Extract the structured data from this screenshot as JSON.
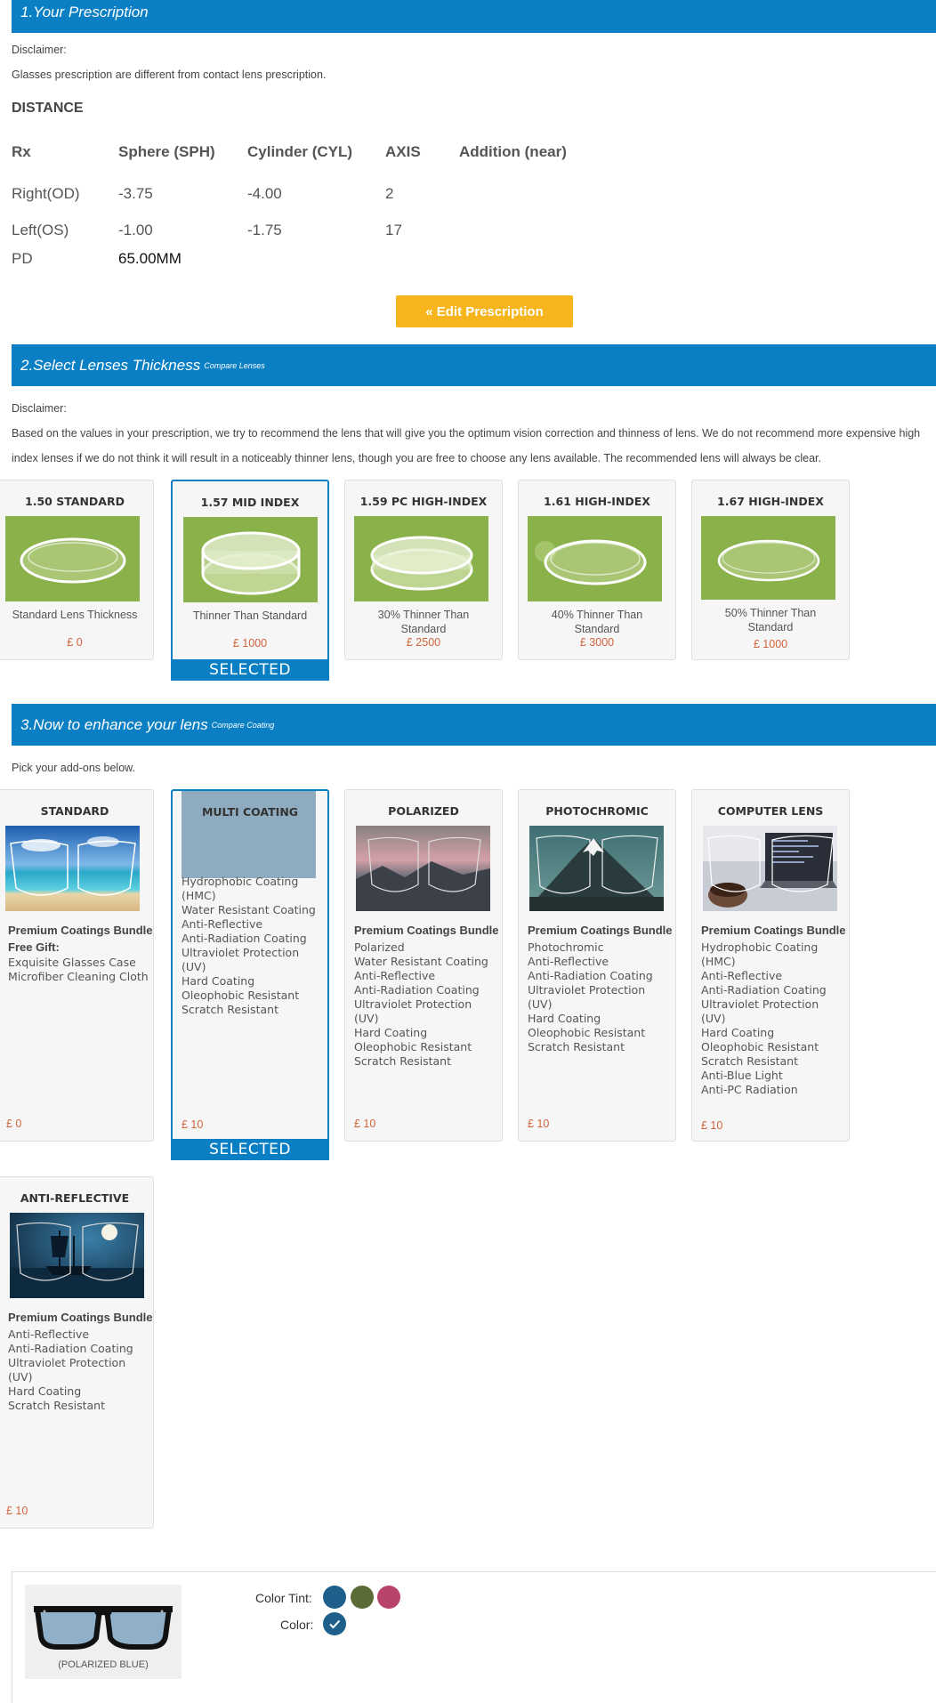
{
  "section1": {
    "title": "1.Your Prescription",
    "disclaimer_label": "Disclaimer:",
    "disclaimer_text": "Glasses prescription are different from contact lens prescription.",
    "distance_heading": "DISTANCE",
    "columns": [
      "Rx",
      "Sphere (SPH)",
      "Cylinder (CYL)",
      "AXIS",
      "Addition (near)"
    ],
    "rows": [
      {
        "label": "Right(OD)",
        "sph": "-3.75",
        "cyl": "-4.00",
        "axis": "2"
      },
      {
        "label": "Left(OS)",
        "sph": "-1.00",
        "cyl": "-1.75",
        "axis": "17"
      }
    ],
    "pd_label": "PD",
    "pd_value": "65.00MM",
    "edit_button": "« Edit Prescription"
  },
  "section2": {
    "title": "2.Select Lenses Thickness",
    "compare_link": "Compare Lenses",
    "disclaimer_label": "Disclaimer:",
    "disclaimer_line1": "Based on the values in your prescription, we try to recommend the lens that will give you the optimum vision correction and thinness of lens. We do not recommend more expensive high",
    "disclaimer_line2": "index lenses if we do not think it will result in a noticeably thinner lens, though you are free to choose any lens available. The recommended lens will always be clear.",
    "lenses": [
      {
        "title": "1.50 STANDARD",
        "desc": "Standard Lens Thickness",
        "price": "£ 0"
      },
      {
        "title": "1.57 MID INDEX",
        "desc": "Thinner Than Standard",
        "price": "£ 1000"
      },
      {
        "title": "1.59 PC HIGH-INDEX",
        "desc": "30% Thinner Than Standard",
        "price": "£ 2500"
      },
      {
        "title": "1.61 HIGH-INDEX",
        "desc": "40% Thinner Than Standard",
        "price": "£ 3000"
      },
      {
        "title": "1.67 HIGH-INDEX",
        "desc": "50% Thinner Than Standard",
        "price": "£ 1000"
      }
    ],
    "selected_label": "SELECTED"
  },
  "section3": {
    "title": "3.Now to enhance your lens",
    "compare_link": "Compare Coating",
    "pick_text": "Pick your add-ons below.",
    "coatings": [
      {
        "title": "STANDARD",
        "subtitle": "Premium Coatings Bundle",
        "gift": "Free Gift:",
        "items": [
          "Exquisite Glasses Case",
          "Microfiber Cleaning Cloth"
        ],
        "price": "£ 0"
      },
      {
        "title": "MULTI COATING",
        "subtitle": "",
        "gift": "",
        "items": [
          "Hydrophobic Coating (HMC)",
          "Water Resistant Coating",
          "Anti-Reflective",
          "Anti-Radiation Coating",
          "Ultraviolet Protection (UV)",
          "Hard Coating",
          "Oleophobic Resistant",
          "Scratch Resistant"
        ],
        "price": "£ 10"
      },
      {
        "title": "POLARIZED",
        "subtitle": "Premium Coatings Bundle",
        "gift": "",
        "items": [
          "Polarized",
          "Water Resistant Coating",
          "Anti-Reflective",
          "Anti-Radiation Coating",
          "Ultraviolet Protection (UV)",
          "Hard Coating",
          "Oleophobic Resistant",
          "Scratch Resistant"
        ],
        "price": "£ 10"
      },
      {
        "title": "PHOTOCHROMIC",
        "subtitle": "Premium Coatings Bundle",
        "gift": "",
        "items": [
          "Photochromic",
          "Anti-Reflective",
          "Anti-Radiation Coating",
          "Ultraviolet Protection (UV)",
          "Hard Coating",
          "Oleophobic Resistant",
          "Scratch Resistant"
        ],
        "price": "£ 10"
      },
      {
        "title": "COMPUTER LENS",
        "subtitle": "Premium Coatings Bundle",
        "gift": "",
        "items": [
          "Hydrophobic Coating (HMC)",
          "Anti-Reflective",
          "Anti-Radiation Coating",
          "Ultraviolet Protection (UV)",
          "Hard Coating",
          "Oleophobic Resistant",
          "Scratch Resistant",
          "Anti-Blue Light",
          "Anti-PC Radiation"
        ],
        "price": "£ 10"
      },
      {
        "title": "ANTI-REFLECTIVE",
        "subtitle": "Premium Coatings Bundle",
        "gift": "",
        "items": [
          "Anti-Reflective",
          "Anti-Radiation Coating",
          "Ultraviolet Protection (UV)",
          "Hard Coating",
          "Scratch Resistant"
        ],
        "price": "£ 10"
      }
    ],
    "selected_label": "SELECTED"
  },
  "tint": {
    "preview_label": "(POLARIZED BLUE)",
    "color_tint_label": "Color Tint:",
    "color_label": "Color:",
    "swatches": [
      "#1d5f8a",
      "#5a6b35",
      "#b8436b"
    ],
    "selected_color": "#1d5f8a"
  }
}
